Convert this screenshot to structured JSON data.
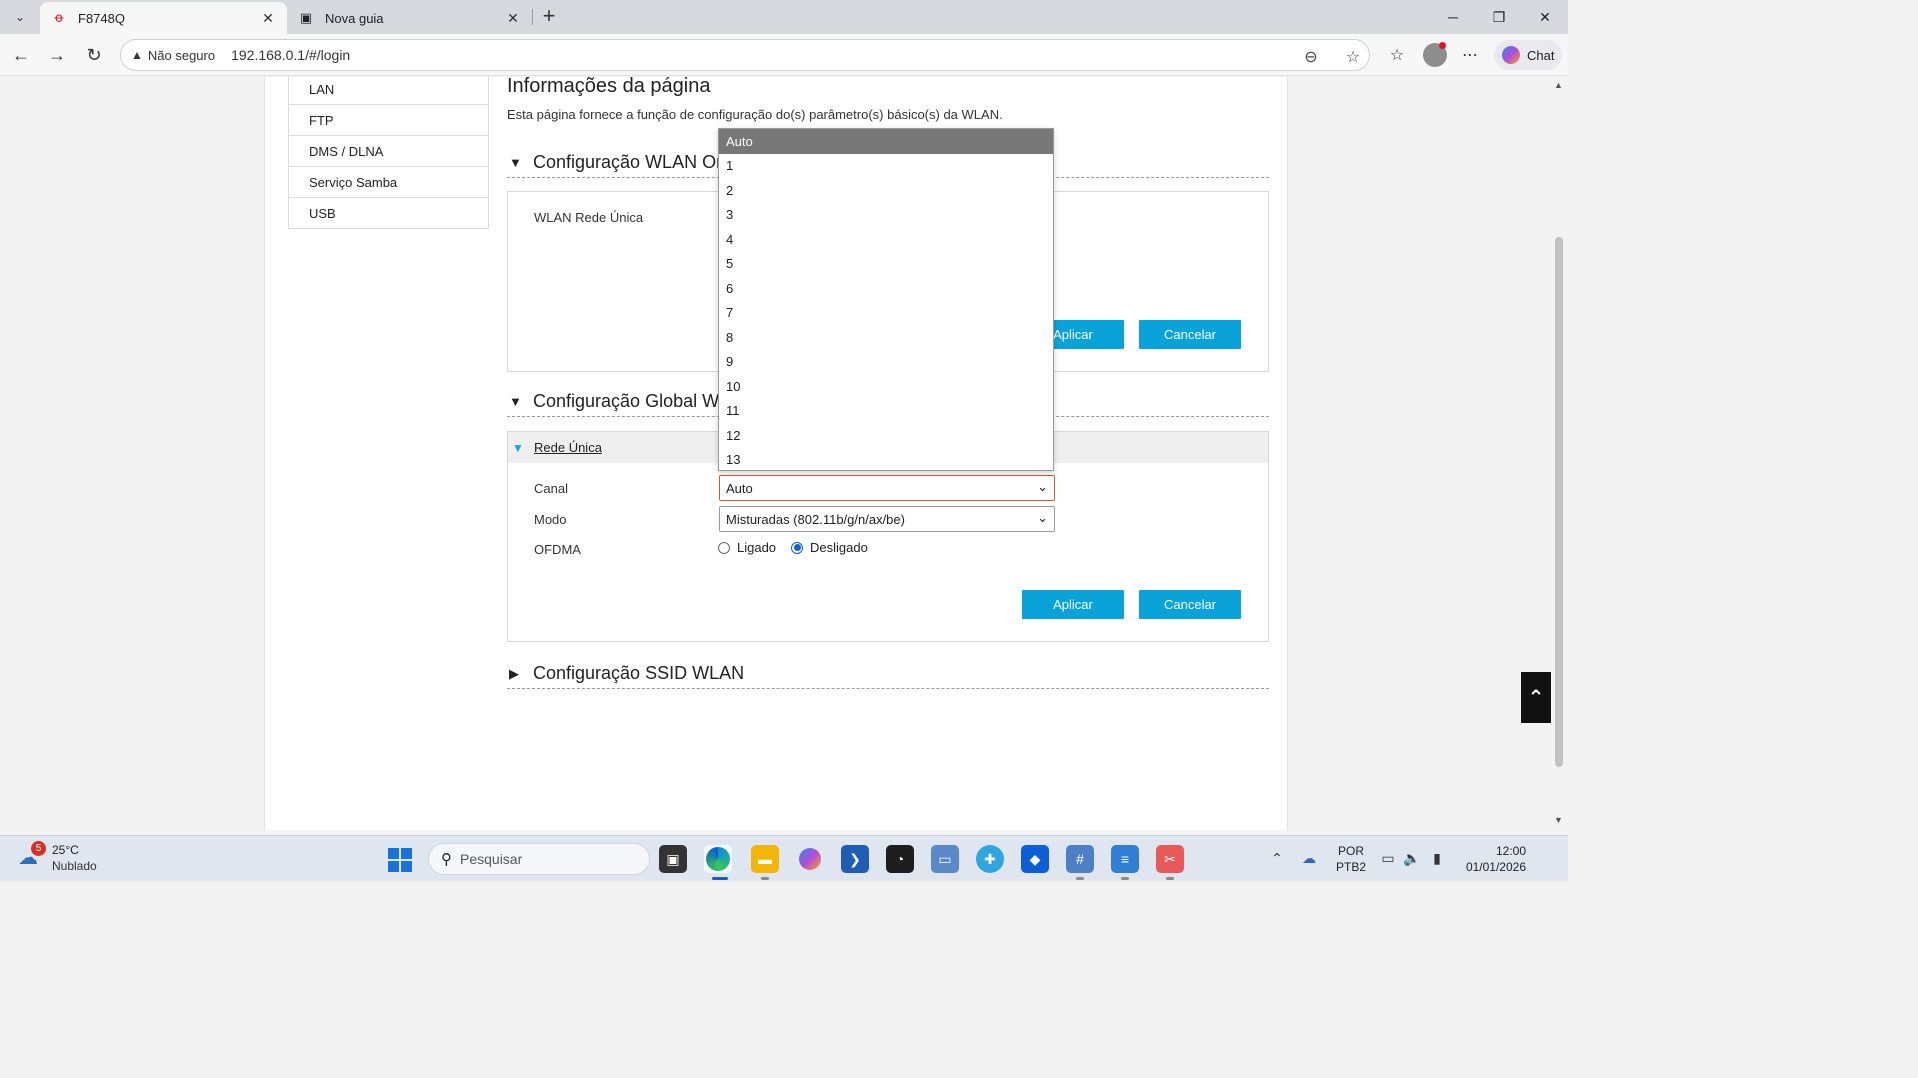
{
  "browser": {
    "tabs": [
      {
        "title": "F8748Q",
        "active": true
      },
      {
        "title": "Nova guia",
        "active": false
      }
    ],
    "security_label": "Não seguro",
    "url": "192.168.0.1/#/login",
    "chat_label": "Chat"
  },
  "sidebar": {
    "items": [
      {
        "label": "LAN"
      },
      {
        "label": "FTP"
      },
      {
        "label": "DMS / DLNA"
      },
      {
        "label": "Serviço Samba"
      },
      {
        "label": "USB"
      }
    ]
  },
  "main": {
    "heading": "Informações da página",
    "description": "Esta página fornece a função de configuração do(s) parâmetro(s) básico(s) da WLAN.",
    "section_wlan_onoff": {
      "title": "Configuração WLAN On",
      "label": "WLAN Rede Única",
      "apply": "Aplicar",
      "cancel": "Cancelar"
    },
    "section_global": {
      "title": "Configuração Global WL",
      "subsection": "Rede Única",
      "canal_label": "Canal",
      "canal_value": "Auto",
      "modo_label": "Modo",
      "modo_value": "Misturadas (802.11b/g/n/ax/be)",
      "ofdma_label": "OFDMA",
      "ofdma_on": "Ligado",
      "ofdma_off": "Desligado",
      "ofdma_selected": "Desligado",
      "apply": "Aplicar",
      "cancel": "Cancelar"
    },
    "section_ssid": {
      "title": "Configuração SSID WLAN"
    },
    "channel_dropdown": {
      "selected": "Auto",
      "options": [
        "Auto",
        "1",
        "2",
        "3",
        "4",
        "5",
        "6",
        "7",
        "8",
        "9",
        "10",
        "11",
        "12",
        "13"
      ]
    }
  },
  "taskbar": {
    "weather_temp": "25°C",
    "weather_desc": "Nublado",
    "weather_badge": "5",
    "search_placeholder": "Pesquisar",
    "lang_line1": "POR",
    "lang_line2": "PTB2",
    "time": "12:00",
    "date": "01/01/2026"
  },
  "colors": {
    "accent_button": "#0aa3d9",
    "dropdown_selected": "#777777",
    "focus_border": "#d9572c"
  }
}
